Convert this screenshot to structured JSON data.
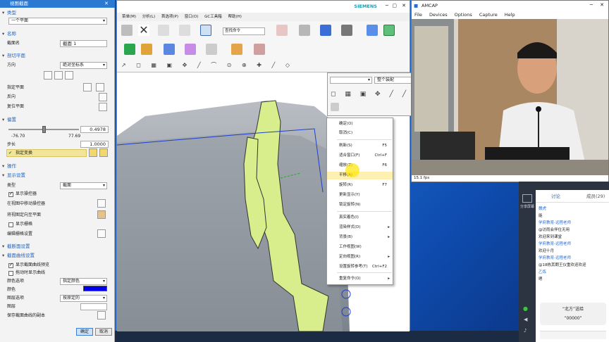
{
  "dialog": {
    "title": "视图截面",
    "sections": {
      "type": "类型",
      "name": "名称",
      "cut_plane": "剖切平面",
      "offset": "偏置",
      "ops": "操作",
      "display": "显示设置",
      "cut_display": "截断面设置",
      "curve": "截面曲线设置"
    },
    "type_value": "一个平面",
    "section_name_label": "截面名",
    "section_name_value": "截面 1",
    "direction_label": "方向",
    "direction_value": "绝对坐标系",
    "specify_plane": "指定平面",
    "reverse": "反向",
    "reset_plane": "复位平面",
    "offset_value": "0.4978",
    "range_min": "-76.70",
    "range_max": "77.69",
    "step_label": "步长",
    "step_value": "1.0000",
    "specify_transform": "指定变换",
    "disp_type_label": "类型",
    "disp_type_value": "截面",
    "show_manipulator": "显示操控器",
    "move_in_view": "在视图中移动操控器",
    "set_view_plane": "将视图定向至平面",
    "show_grid": "显示栅格",
    "edit_grid": "编辑栅格设置",
    "show_section_curve": "显示截面曲线预览",
    "dynamic_update": "拖动时显示曲线",
    "color_option_label": "颜色选项",
    "color_option_value": "指定颜色",
    "color_label": "颜色",
    "color_value": "#0000ee",
    "layer_option_label": "图层选项",
    "layer_option_value": "按原定的",
    "layer_label": "图层",
    "save_copy": "保存截面曲线的副本",
    "ok": "确定",
    "cancel": "取消"
  },
  "nx": {
    "brand": "SIEMENS",
    "menu": [
      "菜单(M)",
      "分析(L)",
      "首选项(P)",
      "窗口(O)",
      "GC工具箱",
      "帮助(H)"
    ],
    "search_placeholder": "查找命令"
  },
  "float_toolbar": {
    "select1": "",
    "select2": "整个装配"
  },
  "context_menu": {
    "items": [
      {
        "label": "确定(O)",
        "shortcut": ""
      },
      {
        "label": "取消(C)",
        "shortcut": ""
      },
      {
        "label": "刷新(S)",
        "shortcut": "F5"
      },
      {
        "label": "适合窗口(F)",
        "shortcut": "Ctrl+F"
      },
      {
        "label": "缩放(Z)",
        "shortcut": "F6"
      },
      {
        "label": "平移(A)",
        "shortcut": ""
      },
      {
        "label": "旋转(R)",
        "shortcut": "F7"
      },
      {
        "label": "更新显示(Y)",
        "shortcut": ""
      },
      {
        "label": "锁定旋转(N)",
        "shortcut": ""
      },
      {
        "label": "真实着色(I)",
        "shortcut": ""
      },
      {
        "label": "渲染样式(D)",
        "shortcut": "▸"
      },
      {
        "label": "背景(B)",
        "shortcut": "▸"
      },
      {
        "label": "工作视图(W)",
        "shortcut": ""
      },
      {
        "label": "定向视图(R)",
        "shortcut": "▸"
      },
      {
        "label": "设置旋转参考(T)",
        "shortcut": "Ctrl+F2"
      },
      {
        "label": "重复命令(O)",
        "shortcut": "▸"
      }
    ]
  },
  "amcap": {
    "title": "AMCAP",
    "menu": [
      "File",
      "Devices",
      "Options",
      "Capture",
      "Help"
    ],
    "status": "15.1 fps"
  },
  "chat": {
    "tab_discuss": "讨论",
    "tab_members": "成员(29)",
    "share_label": "分享屏幕",
    "messages": [
      {
        "name": "魏虎",
        "text": "能"
      },
      {
        "name": "学府教育-远程老师",
        "text": "@访雨会伴位无用"
      },
      {
        "name": "",
        "text": "欢迎来到课堂"
      },
      {
        "name": "学府教育-远程老师",
        "text": "欢迎十月"
      },
      {
        "name": "学府教育-远程老师",
        "text": "@18栋其朗王仪重欢迎欢迎"
      },
      {
        "name": "乙炼",
        "text": "嗯"
      }
    ],
    "gift_text": "“北方”送给",
    "gift_count": "“00000”"
  }
}
